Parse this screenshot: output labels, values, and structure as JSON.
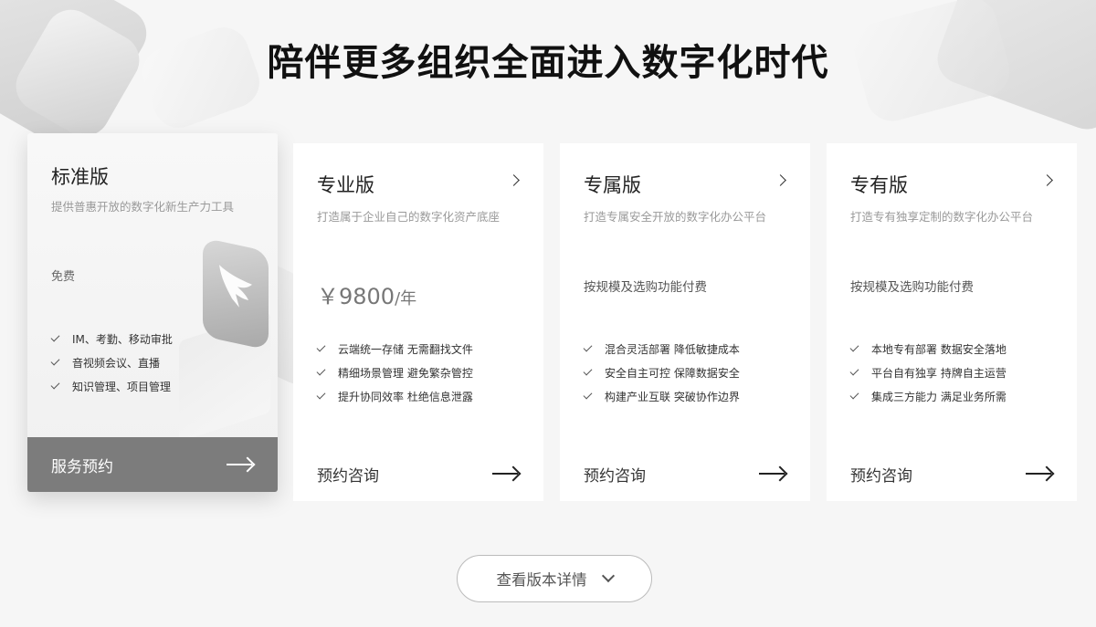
{
  "title": "陪伴更多组织全面进入数字化时代",
  "cards": [
    {
      "name": "标准版",
      "desc": "提供普惠开放的数字化新生产力工具",
      "price_text": "免费",
      "features": [
        "IM、考勤、移动审批",
        "音视频会议、直播",
        "知识管理、项目管理"
      ],
      "cta": "服务预约"
    },
    {
      "name": "专业版",
      "desc": "打造属于企业自己的数字化资产底座",
      "price": "￥9800",
      "price_unit": "/年",
      "features": [
        "云端统一存储 无需翻找文件",
        "精细场景管理 避免繁杂管控",
        "提升协同效率 杜绝信息泄露"
      ],
      "cta": "预约咨询"
    },
    {
      "name": "专属版",
      "desc": "打造专属安全开放的数字化办公平台",
      "pay_text": "按规模及选购功能付费",
      "features": [
        "混合灵活部署 降低敏捷成本",
        "安全自主可控 保障数据安全",
        "构建产业互联 突破协作边界"
      ],
      "cta": "预约咨询"
    },
    {
      "name": "专有版",
      "desc": "打造专有独享定制的数字化办公平台",
      "pay_text": "按规模及选购功能付费",
      "features": [
        "本地专有部署 数据安全落地",
        "平台自有独享 持牌自主运营",
        "集成三方能力 满足业务所需"
      ],
      "cta": "预约咨询"
    }
  ],
  "more_button": "查看版本详情",
  "icons": {
    "card_link": "chevron-right-icon",
    "feature": "check-icon",
    "cta": "arrow-right-icon",
    "more": "chevron-down-icon",
    "app_logo": "dingtalk-logo-icon"
  }
}
